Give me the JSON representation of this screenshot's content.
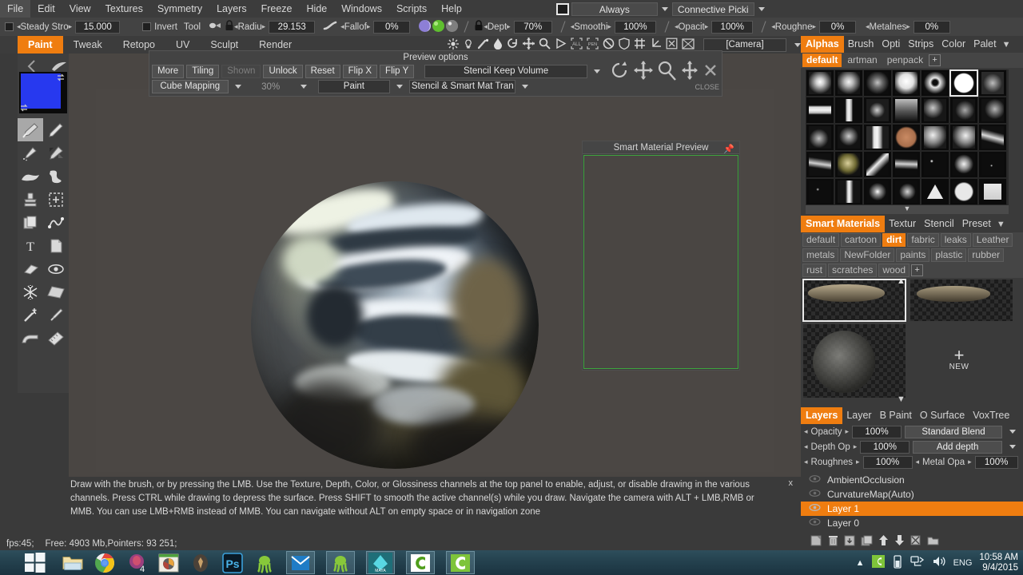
{
  "menu": {
    "items": [
      "File",
      "Edit",
      "View",
      "Textures",
      "Symmetry",
      "Layers",
      "Freeze",
      "Hide",
      "Windows",
      "Scripts",
      "Help"
    ],
    "always_value": "Always",
    "connective_value": "Connective Picki"
  },
  "toolbar": {
    "steady_stroke_label": "Steady Stro",
    "steady_stroke_value": "15.000",
    "invert_label": "Invert",
    "tool_label": "Tool",
    "radius_label": "Radiu",
    "radius_value": "29.153",
    "falloff_label": "Fallof",
    "falloff_value": "0%",
    "depth_label": "Dept",
    "depth_value": "70%",
    "smoothing_label": "Smoothi",
    "smoothing_value": "100%",
    "opacity_label": "Opacit",
    "opacity_value": "100%",
    "roughness_label": "Roughne",
    "roughness_value": "0%",
    "metalness_label": "Metalnes",
    "metalness_value": "0%",
    "camera_value": "[Camera]"
  },
  "tabs": [
    {
      "label": "Paint",
      "active": true
    },
    {
      "label": "Tweak",
      "active": false
    },
    {
      "label": "Retopo",
      "active": false
    },
    {
      "label": "UV",
      "active": false
    },
    {
      "label": "Sculpt",
      "active": false
    },
    {
      "label": "Render",
      "active": false
    }
  ],
  "left_tools": [
    "brush-tool",
    "pen-tool",
    "spray-tool",
    "fill-brush-tool",
    "smudge-tool",
    "blob-tool",
    "stamp-tool",
    "patch-tool",
    "copy-tool",
    "spline-tool",
    "text-tool",
    "page-tool",
    "eraser-tool",
    "eye-tool",
    "freeze-tool",
    "plane-tool",
    "magic-wand-tool",
    "eyedropper-tool",
    "curve-tool",
    "measure-tool"
  ],
  "color_swatch": "#2739ef",
  "preview_options": {
    "title": "Preview options",
    "buttons": [
      "More",
      "Tiling",
      "Shown",
      "Unlock",
      "Reset",
      "Flip X",
      "Flip Y"
    ],
    "disabled_button": "Shown",
    "stencil_keep_volume": "Stencil Keep Volume",
    "mapping": "Cube Mapping",
    "percent": "30%",
    "mode": "Paint",
    "stencil_smart": "Stencil & Smart Mat Tran",
    "close_label": "CLOSE",
    "icons": [
      "rotate-icon",
      "move-icon",
      "zoom-icon",
      "pan-icon",
      "close-icon"
    ]
  },
  "smart_material_preview": {
    "title": "Smart Material Preview",
    "pin_icon": "pin-icon",
    "border_color": "#3ea53e"
  },
  "help": {
    "text": "Draw with the brush, or by pressing the LMB. Use the Texture, Depth, Color, or Glossiness channels at the top panel to enable, adjust, or disable drawing in the various channels. Press CTRL while drawing to depress the surface. Press SHIFT to smooth the active channel(s) while you draw. Navigate the camera with ALT + LMB,RMB or MMB. You can use LMB+RMB instead of MMB. You can navigate without ALT on empty space or in navigation zone",
    "close_label": "x"
  },
  "status": {
    "fps": "fps:45;",
    "memory": "Free: 4903 Mb,Pointers: 93 251;"
  },
  "right_panel": {
    "palette_tabs": [
      {
        "label": "Alphas",
        "active": true
      },
      {
        "label": "Brush",
        "active": false
      },
      {
        "label": "Opti",
        "active": false
      },
      {
        "label": "Strips",
        "active": false
      },
      {
        "label": "Color",
        "active": false
      },
      {
        "label": "Palet",
        "active": false
      }
    ],
    "alpha_folders": [
      {
        "label": "default",
        "active": true
      },
      {
        "label": "artman",
        "active": false
      },
      {
        "label": "penpack",
        "active": false
      }
    ],
    "alpha_add_label": "+",
    "alpha_selected_index": 5,
    "alpha_rows": 5,
    "alpha_cols": 7,
    "alpha_names": [
      "soft-round-alpha",
      "soft-round-alpha-2",
      "faint-round-alpha",
      "hard-round-alpha",
      "ring-alpha",
      "solid-circle-alpha",
      "noise-scratch-alpha",
      "bar-alpha",
      "capsule-alpha",
      "chain-alpha",
      "tube-cluster-alpha",
      "splatter-alpha",
      "smear-alpha",
      "crack-alpha",
      "branch-alpha",
      "tree-alpha",
      "cylinder-alpha",
      "rough-sphere-alpha",
      "dent-sphere-alpha",
      "dent-sphere-alpha-2",
      "grass-alpha",
      "fur-alpha",
      "rock-sphere-alpha",
      "chevron-alpha",
      "hair-strands-alpha",
      "speckle-alpha",
      "blotch-alpha",
      "fine-speckle-alpha",
      "grain-alpha",
      "cylinder-alpha-2",
      "starburst-alpha",
      "chips-alpha",
      "pyramid-alpha",
      "holes-alpha",
      "square-alpha"
    ],
    "material_tabs": [
      {
        "label": "Smart Materials",
        "active": true
      },
      {
        "label": "Textur",
        "active": false
      },
      {
        "label": "Stencil",
        "active": false
      },
      {
        "label": "Preset",
        "active": false
      }
    ],
    "material_folders": [
      {
        "label": "default",
        "active": false
      },
      {
        "label": "cartoon",
        "active": false
      },
      {
        "label": "dirt",
        "active": true
      },
      {
        "label": "fabric",
        "active": false
      },
      {
        "label": "leaks",
        "active": false
      },
      {
        "label": "Leather",
        "active": false
      },
      {
        "label": "metals",
        "active": false
      },
      {
        "label": "NewFolder",
        "active": false
      },
      {
        "label": "paints",
        "active": false
      },
      {
        "label": "plastic",
        "active": false
      },
      {
        "label": "rubber",
        "active": false
      },
      {
        "label": "rust",
        "active": false
      },
      {
        "label": "scratches",
        "active": false
      },
      {
        "label": "wood",
        "active": false
      }
    ],
    "material_add_label": "+",
    "new_material_label": "NEW",
    "scroll_up_icon": "scroll-up-icon",
    "scroll_down_icon": "scroll-down-icon",
    "layers_tabs": [
      {
        "label": "Layers",
        "active": true
      },
      {
        "label": "Layer",
        "active": false
      },
      {
        "label": "B Paint",
        "active": false
      },
      {
        "label": "O Surface",
        "active": false
      },
      {
        "label": "VoxTree",
        "active": false
      }
    ],
    "layer_controls": {
      "opacity_label": "Opacity",
      "opacity_value": "100%",
      "blend_mode": "Standard Blend",
      "depth_opacity_label": "Depth Op",
      "depth_opacity_value": "100%",
      "depth_mode": "Add depth",
      "roughness_label": "Roughnes",
      "roughness_value": "100%",
      "metal_opacity_label": "Metal Opa",
      "metal_opacity_value": "100%"
    },
    "layers": [
      {
        "name": "AmbientOcclusion",
        "visible": false,
        "active": false
      },
      {
        "name": "CurvatureMap(Auto)",
        "visible": false,
        "active": false
      },
      {
        "name": "Layer 1",
        "visible": true,
        "active": true
      },
      {
        "name": "Layer 0",
        "visible": false,
        "active": false
      }
    ],
    "layer_action_icons": [
      "new-layer-icon",
      "delete-layer-icon",
      "merge-down-icon",
      "duplicate-layer-icon",
      "move-up-icon",
      "move-down-icon",
      "clear-layer-icon",
      "folder-icon"
    ]
  },
  "taskbar": {
    "start_icon": "windows-start-icon",
    "pinned": [
      "file-explorer-icon",
      "chrome-icon",
      "media-player-icon",
      "picasa-icon",
      "unity-icon",
      "photoshop-icon",
      "3dcoat-icon",
      "mail-icon",
      "3dcoat-window-icon",
      "maya-icon",
      "coat-green-icon",
      "coat-green-icon-2"
    ],
    "tray_icons": [
      "show-hidden-icon",
      "coat-tray-icon",
      "battery-icon",
      "network-icon",
      "volume-icon"
    ],
    "language": "ENG",
    "time": "10:58 AM",
    "date": "9/4/2015"
  },
  "colors": {
    "accent": "#ef7d10",
    "panel_bg": "#3a3a3a",
    "viewport_bg": "#4a4643",
    "preview_border": "#3ea53e"
  }
}
